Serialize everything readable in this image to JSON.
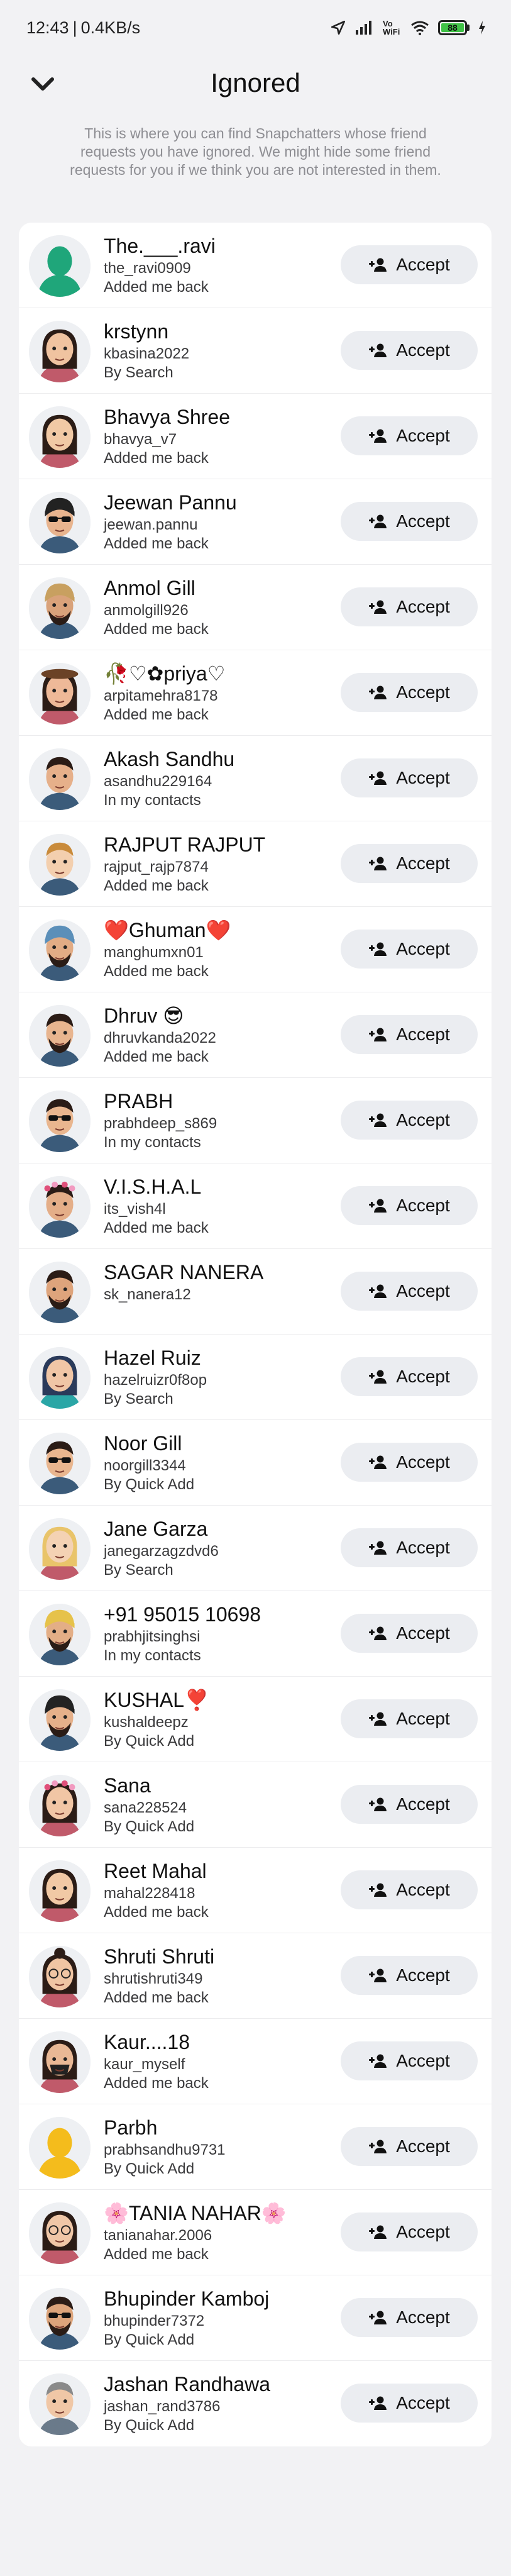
{
  "status_bar": {
    "time": "12:43",
    "speed": "0.4KB/s",
    "network_label": "Vo WiFi",
    "battery": "88"
  },
  "header": {
    "title": "Ignored",
    "description": "This is where you can find Snapchatters whose friend requests you have ignored. We might hide some friend requests for you if we think you are not interested in them."
  },
  "accept_label": "Accept",
  "colors": {
    "accent": "#41c247",
    "button_bg": "#ebedf1"
  },
  "rows": [
    {
      "name": "The.___.ravi",
      "username": "the_ravi0909",
      "source": "Added me back",
      "avatar": "green-ghost"
    },
    {
      "name": "krstynn",
      "username": "kbasina2022",
      "source": "By Search",
      "avatar": "female-long"
    },
    {
      "name": "Bhavya Shree",
      "username": "bhavya_v7",
      "source": "Added me back",
      "avatar": "female-dark"
    },
    {
      "name": "Jeewan Pannu",
      "username": "jeewan.pannu",
      "source": "Added me back",
      "avatar": "male-turban-glasses"
    },
    {
      "name": "Anmol Gill",
      "username": "anmolgill926",
      "source": "Added me back",
      "avatar": "male-turban-beard"
    },
    {
      "name": "🥀♡✿priya♡",
      "username": "arpitamehra8178",
      "source": "Added me back",
      "avatar": "female-hat"
    },
    {
      "name": "Akash Sandhu",
      "username": "asandhu229164",
      "source": "In my contacts",
      "avatar": "male-short"
    },
    {
      "name": "RAJPUT RAJPUT",
      "username": "rajput_rajp7874",
      "source": "Added me back",
      "avatar": "male-blond"
    },
    {
      "name": "❤️Ghuman❤️",
      "username": "manghumxn01",
      "source": "Added me back",
      "avatar": "male-turban-blue"
    },
    {
      "name": "Dhruv 😎",
      "username": "dhruvkanda2022",
      "source": "Added me back",
      "avatar": "male-beard"
    },
    {
      "name": "PRABH",
      "username": "prabhdeep_s869",
      "source": "In my contacts",
      "avatar": "male-sunglasses"
    },
    {
      "name": "V.I.S.H.A.L",
      "username": "its_vish4l",
      "source": "Added me back",
      "avatar": "male-flowers"
    },
    {
      "name": "SAGAR NANERA",
      "username": "sk_nanera12",
      "source": "",
      "avatar": "male-mustache"
    },
    {
      "name": "Hazel Ruiz",
      "username": "hazelruizr0f8op",
      "source": "By Search",
      "avatar": "female-teal"
    },
    {
      "name": "Noor Gill",
      "username": "noorgill3344",
      "source": "By Quick Add",
      "avatar": "male-sunglasses"
    },
    {
      "name": "Jane Garza",
      "username": "janegarzagzdvd6",
      "source": "By Search",
      "avatar": "female-blonde"
    },
    {
      "name": "+91 95015 10698",
      "username": "prabhjitsinghsi",
      "source": "In my contacts",
      "avatar": "male-turban-yellow"
    },
    {
      "name": "KUSHAL❣️",
      "username": "kushaldeepz",
      "source": "By Quick Add",
      "avatar": "male-turban-dark"
    },
    {
      "name": "Sana",
      "username": "sana228524",
      "source": "By Quick Add",
      "avatar": "female-flowers"
    },
    {
      "name": "Reet Mahal",
      "username": "mahal228418",
      "source": "Added me back",
      "avatar": "female-dark"
    },
    {
      "name": "Shruti Shruti",
      "username": "shrutishruti349",
      "source": "Added me back",
      "avatar": "female-bun"
    },
    {
      "name": "Kaur....18",
      "username": "kaur_myself",
      "source": "Added me back",
      "avatar": "female-mask"
    },
    {
      "name": "Parbh",
      "username": "prabhsandhu9731",
      "source": "By Quick Add",
      "avatar": "yellow-ghost"
    },
    {
      "name": "🌸TANIA NAHAR🌸",
      "username": "tanianahar.2006",
      "source": "Added me back",
      "avatar": "female-glasses"
    },
    {
      "name": "Bhupinder Kamboj",
      "username": "bhupinder7372",
      "source": "By Quick Add",
      "avatar": "male-beard-sunglasses"
    },
    {
      "name": "Jashan Randhawa",
      "username": "jashan_rand3786",
      "source": "By Quick Add",
      "avatar": "male-grey"
    }
  ]
}
